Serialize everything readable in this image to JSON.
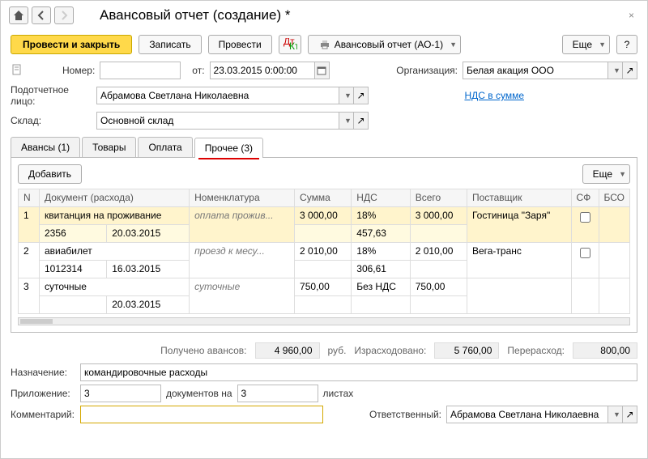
{
  "titlebar": {
    "title": "Авансовый отчет (создание) *"
  },
  "toolbar": {
    "post_close": "Провести и закрыть",
    "save": "Записать",
    "post": "Провести",
    "print": "Авансовый отчет (АО-1)",
    "more": "Еще",
    "help": "?"
  },
  "form": {
    "number_lbl": "Номер:",
    "number": "",
    "date_lbl": "от:",
    "date": "23.03.2015 0:00:00",
    "org_lbl": "Организация:",
    "org": "Белая акация ООО",
    "person_lbl": "Подотчетное лицо:",
    "person": "Абрамова Светлана Николаевна",
    "vat_link": "НДС в сумме",
    "warehouse_lbl": "Склад:",
    "warehouse": "Основной склад"
  },
  "tabs": [
    "Авансы (1)",
    "Товары",
    "Оплата",
    "Прочее (3)"
  ],
  "tabtools": {
    "add": "Добавить",
    "more": "Еще"
  },
  "grid": {
    "headers": [
      "N",
      "Документ (расхода)",
      "Номенклатура",
      "Сумма",
      "НДС",
      "Всего",
      "Поставщик",
      "СФ",
      "БСО"
    ],
    "rows": [
      {
        "n": "1",
        "doc": "квитанция на проживание",
        "doc_num": "2356",
        "doc_date": "20.03.2015",
        "nomen": "оплата прожив...",
        "sum": "3 000,00",
        "vat_rate": "18%",
        "vat_sum": "457,63",
        "total": "3 000,00",
        "supplier": "Гостиница \"Заря\"",
        "sf": false
      },
      {
        "n": "2",
        "doc": "авиабилет",
        "doc_num": "1012314",
        "doc_date": "16.03.2015",
        "nomen": "проезд к месу...",
        "sum": "2 010,00",
        "vat_rate": "18%",
        "vat_sum": "306,61",
        "total": "2 010,00",
        "supplier": "Вега-транс",
        "sf": false
      },
      {
        "n": "3",
        "doc": "суточные",
        "doc_num": "",
        "doc_date": "20.03.2015",
        "nomen": "суточные",
        "sum": "750,00",
        "vat_rate": "Без НДС",
        "vat_sum": "",
        "total": "750,00",
        "supplier": "",
        "sf": false
      }
    ]
  },
  "totals": {
    "advance_lbl": "Получено авансов:",
    "advance": "4 960,00",
    "currency": "руб.",
    "spent_lbl": "Израсходовано:",
    "spent": "5 760,00",
    "over_lbl": "Перерасход:",
    "over": "800,00"
  },
  "footer": {
    "purpose_lbl": "Назначение:",
    "purpose": "командировочные расходы",
    "attach_lbl": "Приложение:",
    "attach_docs": "3",
    "attach_docs_lbl": "документов на",
    "attach_pages": "3",
    "attach_pages_lbl": "листах",
    "comment_lbl": "Комментарий:",
    "comment": "",
    "responsible_lbl": "Ответственный:",
    "responsible": "Абрамова Светлана Николаевна"
  }
}
